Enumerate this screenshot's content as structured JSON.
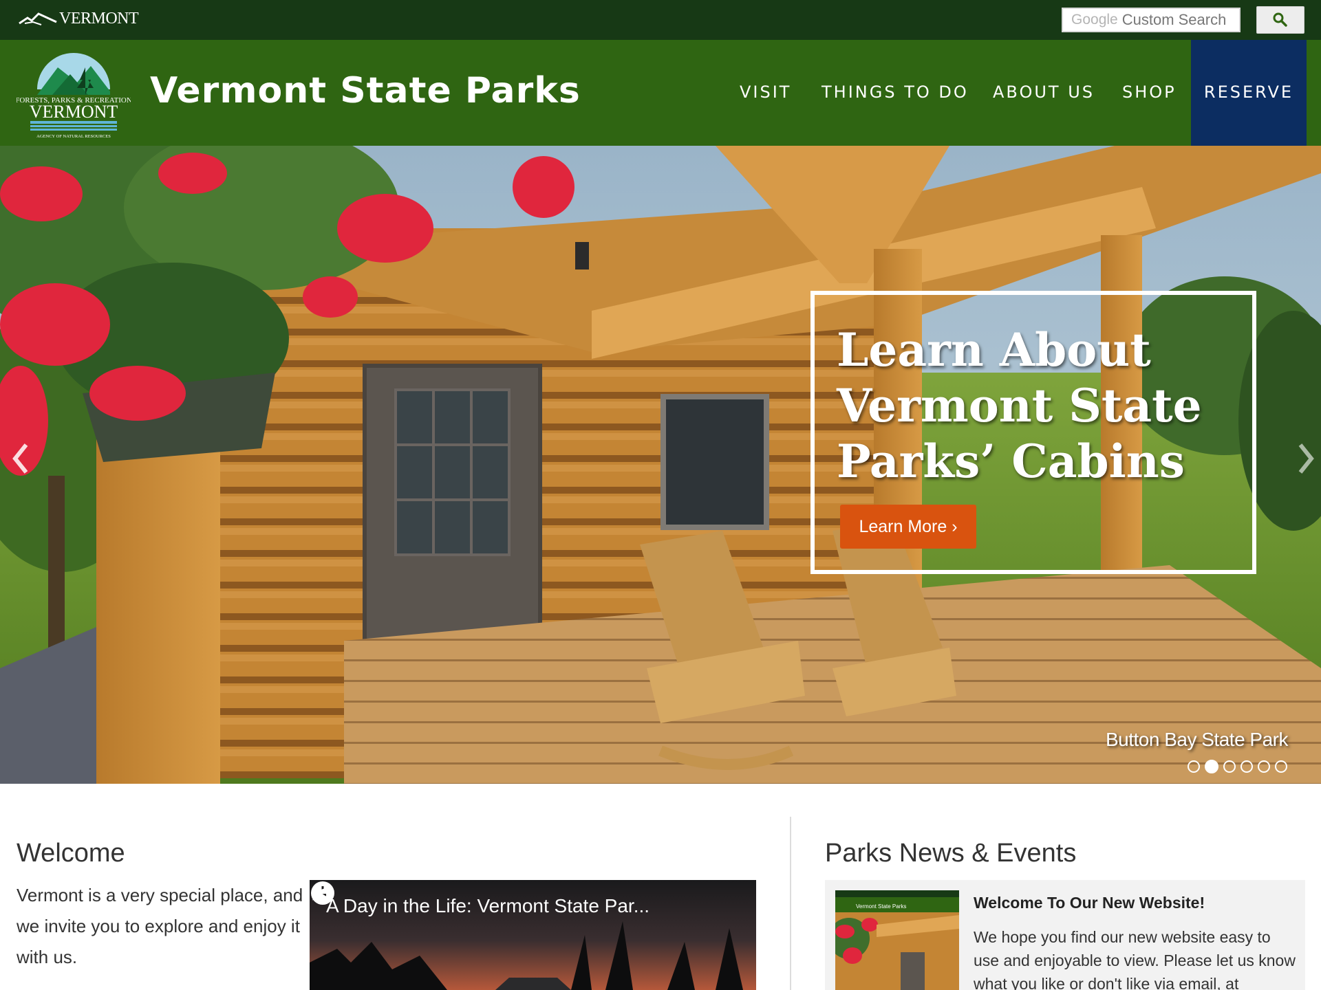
{
  "topbar": {
    "vt_logo_text": "VERMONT",
    "search_brand": "Google",
    "search_placeholder": "Custom Search",
    "search_icon": "magnifier-icon"
  },
  "header": {
    "site_title": "Vermont State Parks",
    "logo_lines": [
      "FORESTS, PARKS & RECREATION",
      "VERMONT",
      "AGENCY OF NATURAL RESOURCES"
    ],
    "nav": [
      "VISIT",
      "THINGS TO DO",
      "ABOUT US",
      "SHOP"
    ],
    "reserve_label": "RESERVE",
    "colors": {
      "header_bg": "#2f6512",
      "topbar_bg": "#173915",
      "reserve_bg": "#0c2d61"
    }
  },
  "hero": {
    "headline": "Learn About Vermont State Parks’ Cabins",
    "button_label": "Learn More ›",
    "caption": "Button Bay State Park",
    "slides_total": 6,
    "active_slide": 2,
    "button_color": "#d9530f"
  },
  "welcome": {
    "title": "Welcome",
    "text": "Vermont is a very special place, and we invite you to explore and enjoy it with us.",
    "video_title": "A Day in the Life: Vermont State Par...",
    "video_icons": [
      "clock-icon",
      "share-icon"
    ]
  },
  "news": {
    "title": "Parks News & Events",
    "item_title": "Welcome To Our New Website!",
    "item_text": "We hope you find our new website easy to use and enjoyable to view. Please let us know what you like or don't like via email, at",
    "thumb_label": "Vermont State Parks"
  }
}
